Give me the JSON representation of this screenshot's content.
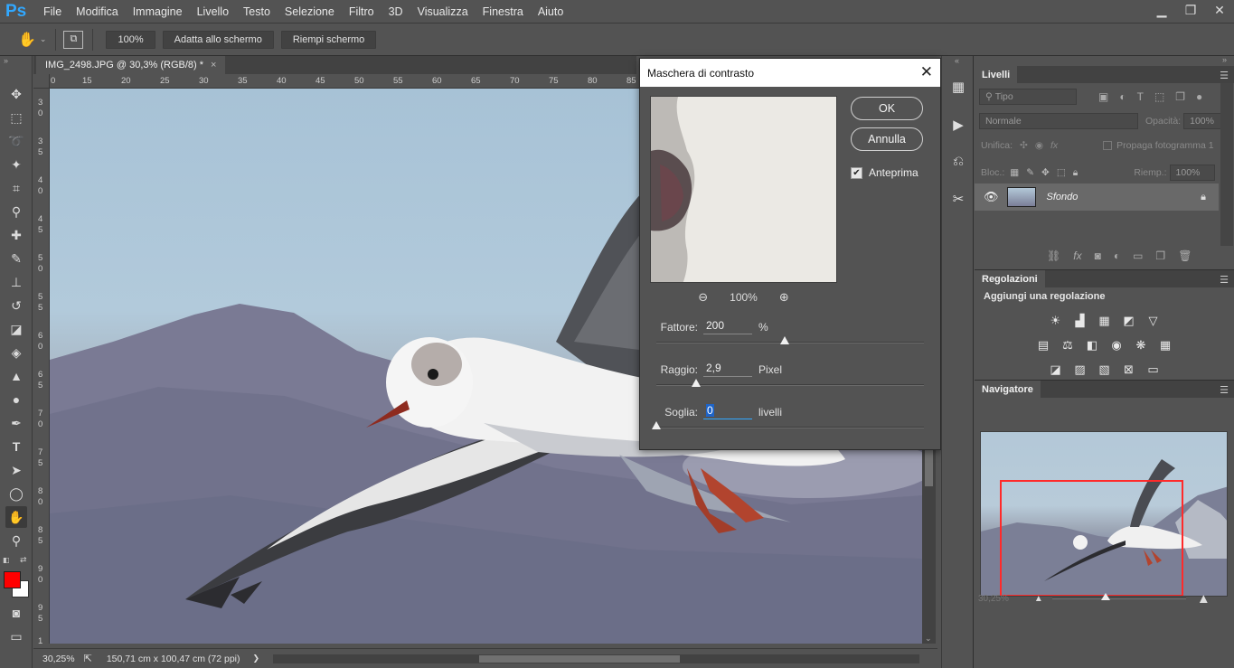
{
  "app": {
    "logo": "Ps",
    "menu": [
      "File",
      "Modifica",
      "Immagine",
      "Livello",
      "Testo",
      "Selezione",
      "Filtro",
      "3D",
      "Visualizza",
      "Finestra",
      "Aiuto"
    ],
    "window_controls": [
      "minimize-icon",
      "restore-icon",
      "close-icon"
    ]
  },
  "options_bar": {
    "zoom_value": "100%",
    "fit_screen": "Adatta allo schermo",
    "fill_screen": "Riempi schermo"
  },
  "document": {
    "tab_title": "IMG_2498.JPG @ 30,3% (RGB/8) *",
    "tab_close": "×",
    "ruler_h": [
      "0",
      "15",
      "20",
      "25",
      "30",
      "35",
      "40",
      "45",
      "50",
      "55",
      "60",
      "65",
      "70",
      "75",
      "80",
      "85"
    ],
    "ruler_v": [
      "3",
      "0",
      "3",
      "5",
      "4",
      "0",
      "4",
      "5",
      "5",
      "0",
      "5",
      "5",
      "6",
      "0",
      "6",
      "5",
      "7",
      "0",
      "7",
      "5",
      "8",
      "0",
      "8",
      "5",
      "9",
      "0",
      "9",
      "5",
      "1"
    ]
  },
  "status_bar": {
    "zoom": "30,25%",
    "doc_size": "150,71 cm x 100,47 cm (72 ppi)",
    "arrow": "❯"
  },
  "dialog": {
    "title": "Maschera di contrasto",
    "ok": "OK",
    "cancel": "Annulla",
    "preview_label": "Anteprima",
    "preview_checked": true,
    "zoom_level": "100%",
    "amount_label": "Fattore:",
    "amount_value": "200",
    "amount_unit": "%",
    "amount_fraction": 0.48,
    "radius_label": "Raggio:",
    "radius_value": "2,9",
    "radius_unit": "Pixel",
    "radius_fraction": 0.15,
    "threshold_label": "Soglia:",
    "threshold_value": "0",
    "threshold_unit": "livelli",
    "threshold_fraction": 0.0
  },
  "layers_panel": {
    "tab": "Livelli",
    "filter_placeholder": "Tipo",
    "blend_mode": "Normale",
    "opacity_label": "Opacità:",
    "opacity_value": "100%",
    "unify_label": "Unifica:",
    "propagate_label": "Propaga fotogramma 1",
    "lock_label": "Bloc.:",
    "fill_label": "Riemp.:",
    "fill_value": "100%",
    "layer_name": "Sfondo"
  },
  "adjustments_panel": {
    "tab": "Regolazioni",
    "subtitle": "Aggiungi una regolazione"
  },
  "navigator_panel": {
    "tab": "Navigatore",
    "zoom": "30,25%"
  },
  "colors": {
    "foreground": "#ff0000",
    "background": "#ffffff",
    "accent": "#31a8ff"
  }
}
